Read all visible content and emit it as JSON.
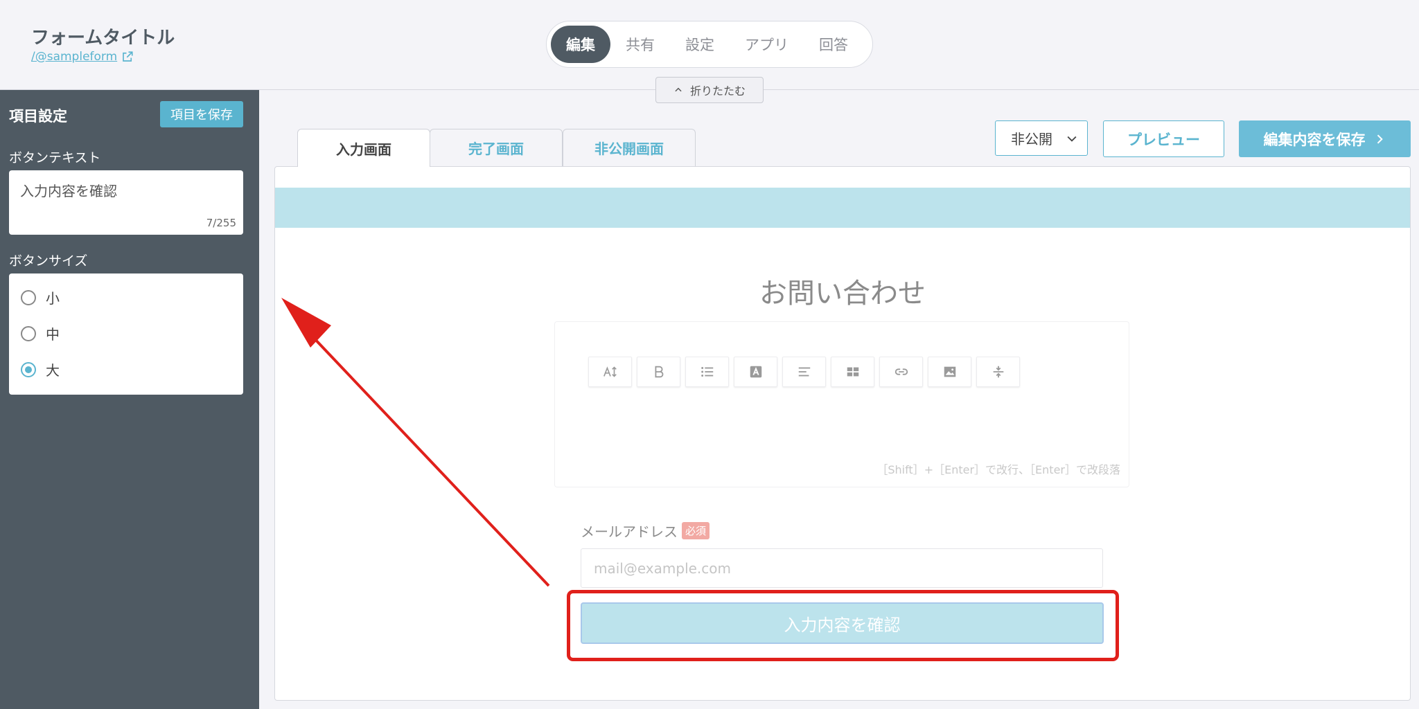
{
  "header": {
    "form_title": "フォームタイトル",
    "form_link": "/@sampleform",
    "nav": [
      "編集",
      "共有",
      "設定",
      "アプリ",
      "回答"
    ],
    "nav_active": "編集",
    "collapse_label": "折りたたむ"
  },
  "sidebar": {
    "title": "項目設定",
    "save_label": "項目を保存",
    "button_text_label": "ボタンテキスト",
    "button_text_value": "入力内容を確認",
    "button_text_count": "7/255",
    "button_size_label": "ボタンサイズ",
    "sizes": [
      "小",
      "中",
      "大"
    ],
    "selected_size": "大"
  },
  "main": {
    "tabs": [
      "入力画面",
      "完了画面",
      "非公開画面"
    ],
    "active_tab": "入力画面",
    "visibility": "非公開",
    "preview_label": "プレビュー",
    "save_edit_label": "編集内容を保存",
    "form_heading": "お問い合わせ",
    "editor_hint": "［Shift］+［Enter］で改行、［Enter］で改段落",
    "email_label": "メールアドレス",
    "required_badge": "必須",
    "email_placeholder": "mail@example.com",
    "confirm_button": "入力内容を確認"
  },
  "toolbar_icons": [
    "text-size-icon",
    "bold-icon",
    "list-icon",
    "text-color-icon",
    "align-icon",
    "table-icon",
    "link-icon",
    "image-icon",
    "divider-icon"
  ],
  "colors": {
    "accent": "#5ab4cf",
    "sidebar_bg": "#4f5a63",
    "banner": "#bce3ec",
    "annotation_red": "#e0201b"
  }
}
